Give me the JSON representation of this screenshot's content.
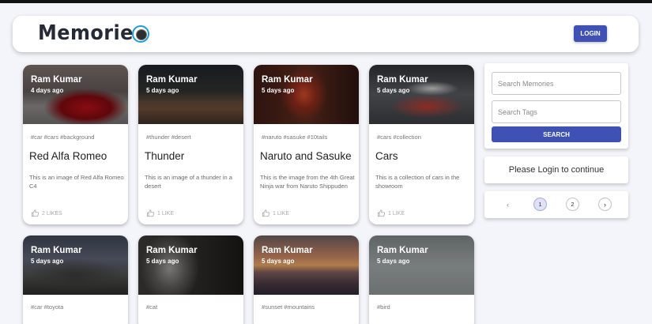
{
  "app": {
    "brand": "Memories",
    "login_label": "LOGIN"
  },
  "posts": [
    {
      "author": "Ram Kumar",
      "time": "4 days ago",
      "tags": "#car #cars #background",
      "title": "Red Alfa Romeo",
      "message": "This is an image of Red Alfa Romeo C4",
      "likes": "2 LIKES"
    },
    {
      "author": "Ram Kumar",
      "time": "5 days ago",
      "tags": "#thunder #desert",
      "title": "Thunder",
      "message": "This is an image of a thunder in a desert",
      "likes": "1 LIKE"
    },
    {
      "author": "Ram Kumar",
      "time": "5 days ago",
      "tags": "#naruto #sasuke #10tails",
      "title": "Naruto and Sasuke",
      "message": "This is the image from the 4th Great Ninja war from Naruto Shippuden",
      "likes": "1 LIKE"
    },
    {
      "author": "Ram Kumar",
      "time": "5 days ago",
      "tags": "#cars #collection",
      "title": "Cars",
      "message": "This is a collection of cars in the showroom",
      "likes": "1 LIKE"
    },
    {
      "author": "Ram Kumar",
      "time": "5 days ago",
      "tags": "#car #toyota"
    },
    {
      "author": "Ram Kumar",
      "time": "5 days ago",
      "tags": "#cat"
    },
    {
      "author": "Ram Kumar",
      "time": "5 days ago",
      "tags": "#sunset #mountains"
    },
    {
      "author": "Ram Kumar",
      "time": "5 days ago",
      "tags": "#bird"
    }
  ],
  "sidebar": {
    "search_placeholder": "Search Memories",
    "tags_placeholder": "Search Tags",
    "search_label": "SEARCH",
    "login_message": "Please Login to continue"
  },
  "pagination": {
    "prev_icon": "‹",
    "pages": [
      "1",
      "2"
    ],
    "current": "1",
    "next_icon": "›"
  },
  "icons": {
    "logo": "camera-lens-icon",
    "like": "thumb-up-icon"
  },
  "colors": {
    "primary": "#3f51b5",
    "background": "#f4f5fa"
  }
}
